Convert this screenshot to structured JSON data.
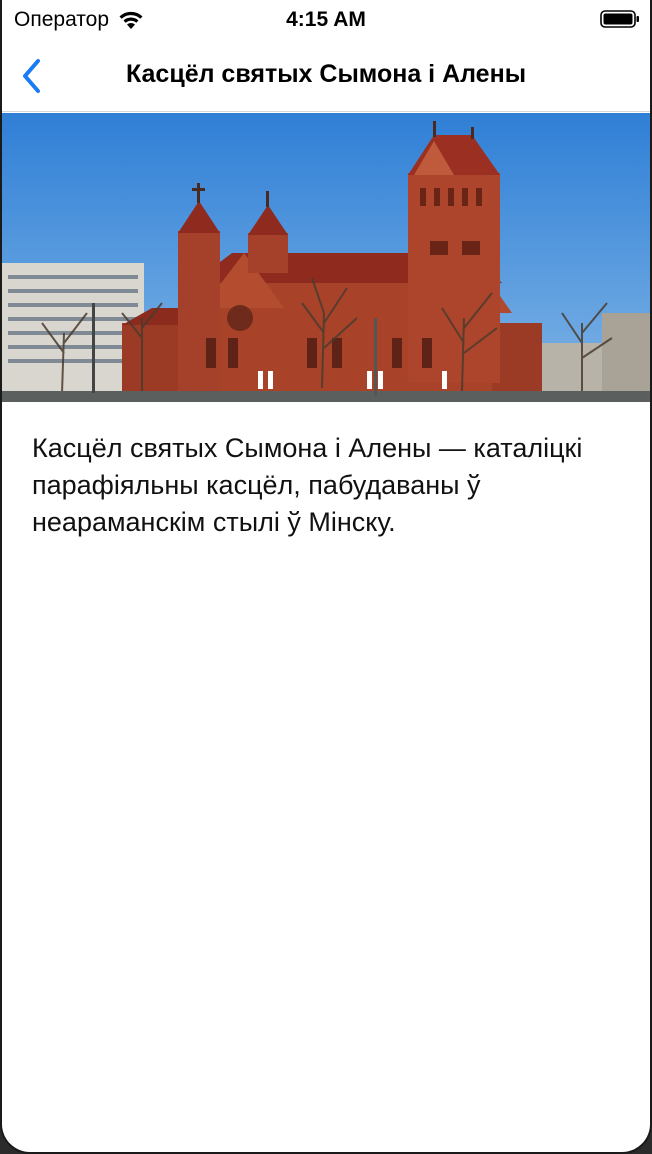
{
  "status_bar": {
    "carrier": "Оператор",
    "time": "4:15 AM",
    "icons": [
      "wifi-icon",
      "battery-icon"
    ]
  },
  "nav": {
    "title": "Касцёл святых Сымона і Алены",
    "back_icon": "chevron-left-icon",
    "accent_color": "#1a7cf5"
  },
  "hero_image": {
    "subject": "church-photo"
  },
  "content": {
    "description": "Касцёл святых Сымона і Алены — каталіцкі парафіяльны касцёл, пабудаваны ў неараманскім стылі ў Мінску."
  }
}
